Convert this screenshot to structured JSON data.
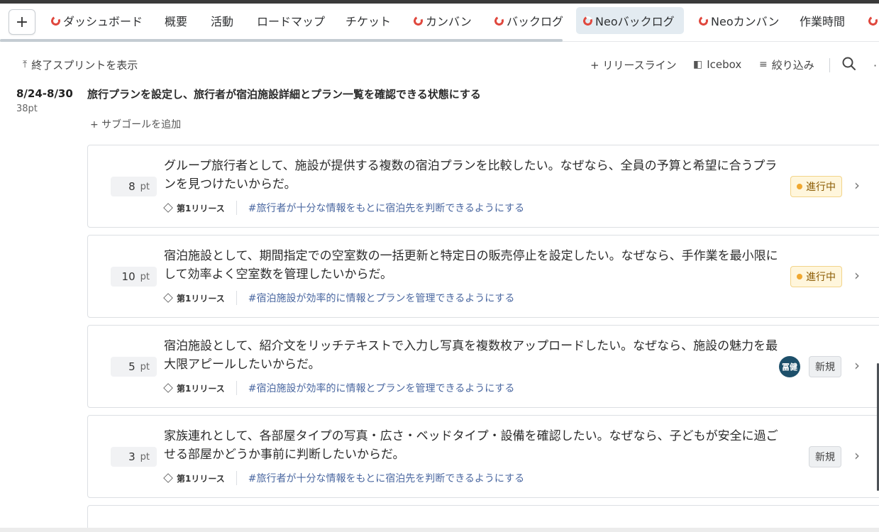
{
  "tabs": {
    "add_label": "+",
    "items": [
      {
        "label": "ダッシュボード",
        "icon": "ring-icon"
      },
      {
        "label": "概要"
      },
      {
        "label": "活動"
      },
      {
        "label": "ロードマップ"
      },
      {
        "label": "チケット"
      },
      {
        "label": "カンバン",
        "icon": "ring-icon"
      },
      {
        "label": "バックログ",
        "icon": "ring-icon"
      },
      {
        "label": "Neoバックログ",
        "icon": "ring-icon",
        "active": true
      },
      {
        "label": "Neoカンバン",
        "icon": "ring-icon"
      },
      {
        "label": "作業時間"
      }
    ]
  },
  "toolbar": {
    "show_finished": "終了スプリントを表示",
    "release_line": "+ リリースライン",
    "icebox": "Icebox",
    "filter": "絞り込み"
  },
  "sprint": {
    "date": "8/24-8/30",
    "points": "38pt",
    "goal": "旅行プランを設定し、旅行者が宿泊施設詳細とプラン一覧を確認できる状態にする",
    "add_subgoal": "+ サブゴールを追加"
  },
  "cards": [
    {
      "points": "8",
      "unit": "pt",
      "story": "グループ旅行者として、施設が提供する複数の宿泊プランを比較したい。なぜなら、全員の予算と希望に合うプランを見つけたいからだ。",
      "release": "第1リリース",
      "goal_tag": "#旅行者が十分な情報をもとに宿泊先を判断できるようにする",
      "status": "進行中"
    },
    {
      "points": "10",
      "unit": "pt",
      "story": "宿泊施設として、期間指定での空室数の一括更新と特定日の販売停止を設定したい。なぜなら、手作業を最小限にして効率よく空室数を管理したいからだ。",
      "release": "第1リリース",
      "goal_tag": "#宿泊施設が効率的に情報とプランを管理できるようにする",
      "status": "進行中"
    },
    {
      "points": "5",
      "unit": "pt",
      "story": "宿泊施設として、紹介文をリッチテキストで入力し写真を複数枚アップロードしたい。なぜなら、施設の魅力を最大限アピールしたいからだ。",
      "release": "第1リリース",
      "goal_tag": "#宿泊施設が効率的に情報とプランを管理できるようにする",
      "status": "新規",
      "assignee": "冨健"
    },
    {
      "points": "3",
      "unit": "pt",
      "story": "家族連れとして、各部屋タイプの写真・広さ・ベッドタイプ・設備を確認したい。なぜなら、子どもが安全に過ごせる部屋かどうか事前に判断したいからだ。",
      "release": "第1リリース",
      "goal_tag": "#旅行者が十分な情報をもとに宿泊先を判断できるようにする",
      "status": "新規"
    }
  ],
  "colors": {
    "accent_ring": "#e0483e",
    "active_tab_bg": "#e3ebf1",
    "in_progress_bg": "#fff6dc",
    "link": "#4a67a0",
    "avatar_bg": "#1d4f6a"
  }
}
